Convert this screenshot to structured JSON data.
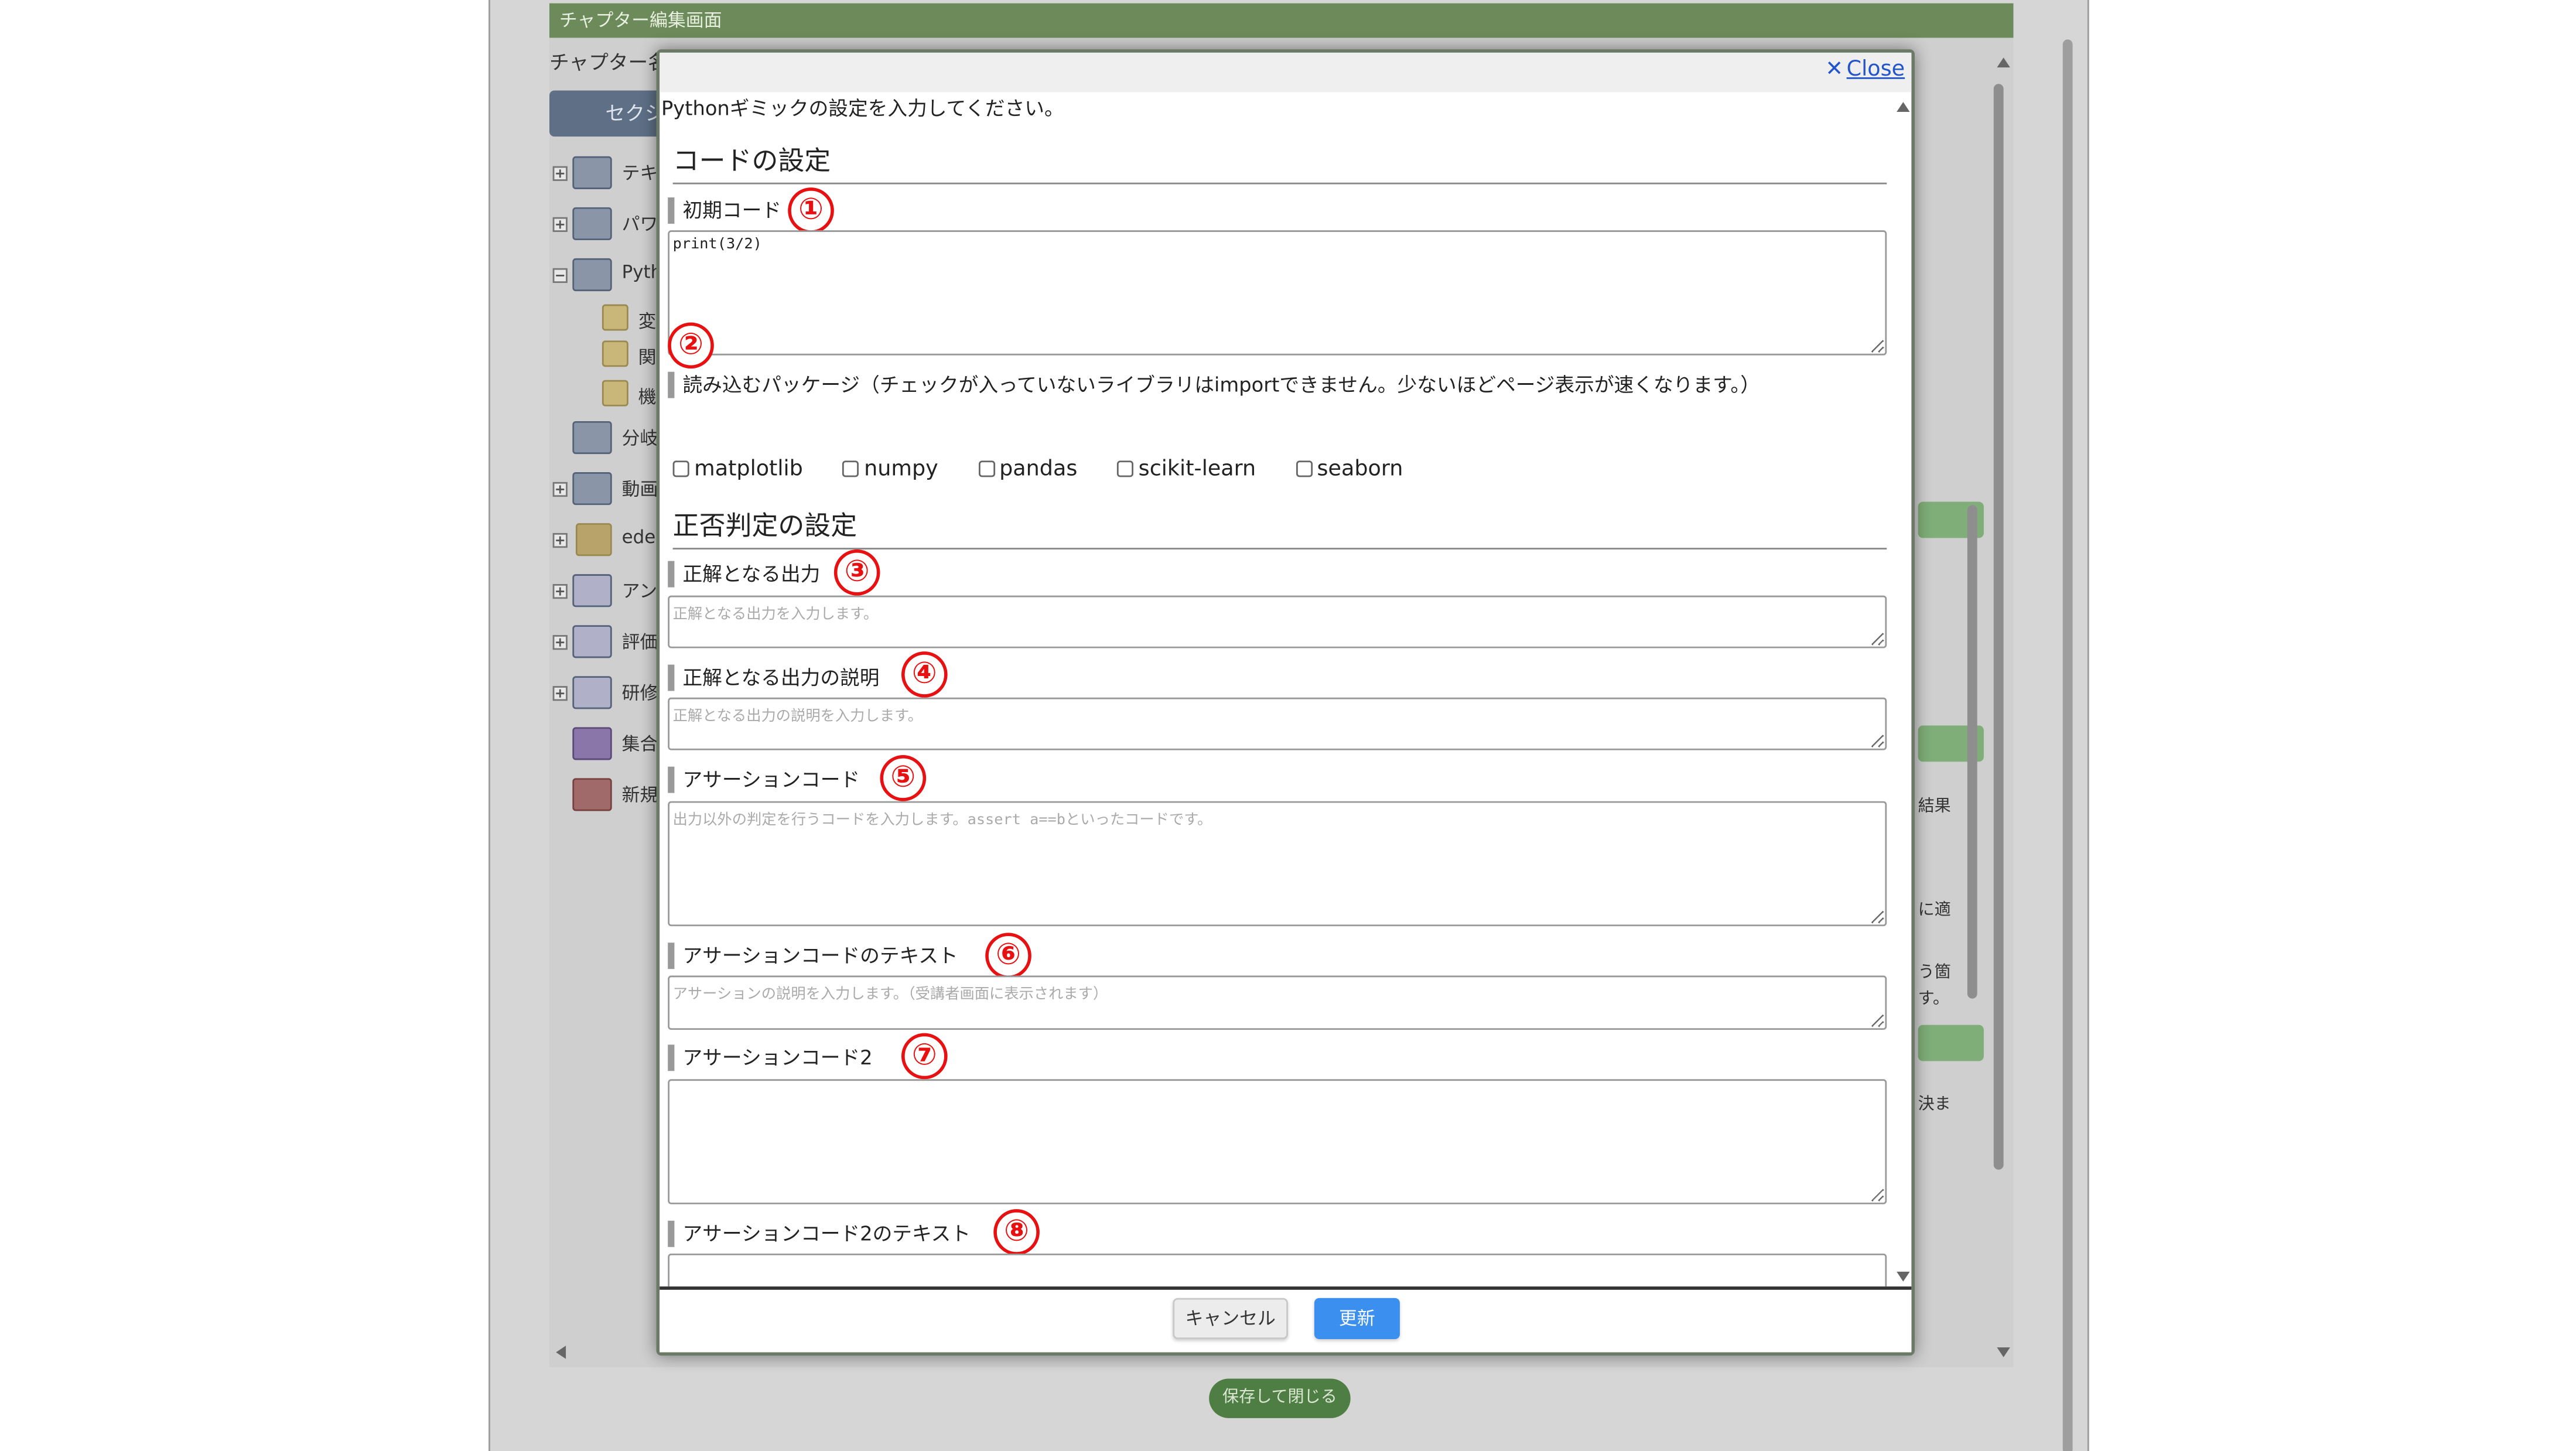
{
  "page": {
    "title": "チャプター編集画面",
    "chapter_label": "チャプター名",
    "section_button": "セクシ",
    "tree_items": [
      {
        "label": "テキ",
        "sub": false,
        "icon": "slide-icon",
        "toggle": "plus"
      },
      {
        "label": "パワ",
        "sub": false,
        "icon": "slide-icon",
        "toggle": "plus"
      },
      {
        "label": "Pyth",
        "sub": false,
        "icon": "slide-icon",
        "toggle": "minus"
      },
      {
        "label": "変",
        "sub": true,
        "icon": "note-icon",
        "toggle": ""
      },
      {
        "label": "関",
        "sub": true,
        "icon": "note-icon",
        "toggle": ""
      },
      {
        "label": "機",
        "sub": true,
        "icon": "note-icon",
        "toggle": ""
      },
      {
        "label": "分岐",
        "sub": false,
        "icon": "slide-icon",
        "toggle": ""
      },
      {
        "label": "動画",
        "sub": false,
        "icon": "slide-icon",
        "toggle": "plus"
      },
      {
        "label": "eden",
        "sub": false,
        "icon": "person-icon",
        "toggle": "plus"
      },
      {
        "label": "アン",
        "sub": false,
        "icon": "questionnaire-icon",
        "toggle": "plus"
      },
      {
        "label": "評価",
        "sub": false,
        "icon": "questionnaire-icon",
        "toggle": "plus"
      },
      {
        "label": "研修",
        "sub": false,
        "icon": "questionnaire-icon",
        "toggle": "plus"
      },
      {
        "label": "集合",
        "sub": false,
        "icon": "people-icon",
        "toggle": ""
      },
      {
        "label": "新規",
        "sub": false,
        "icon": "pdf-icon",
        "toggle": ""
      }
    ],
    "right_texts": [
      "結果",
      "に適",
      "う箇",
      "す。",
      "決ま"
    ],
    "save_close_label": "保存して閉じる"
  },
  "dialog": {
    "close_label": "Close",
    "intro": "Pythonギミックの設定を入力してください。",
    "code_section": "コードの設定",
    "initial_code_label": "初期コード",
    "initial_code_value": "print(3/2)",
    "packages_label": "読み込むパッケージ（チェックが入っていないライブラリはimportできません。少ないほどページ表示が速くなります。）",
    "packages": [
      "matplotlib",
      "numpy",
      "pandas",
      "scikit-learn",
      "seaborn"
    ],
    "judge_section": "正否判定の設定",
    "correct_output_label": "正解となる出力",
    "correct_output_placeholder": "正解となる出力を入力します。",
    "correct_output_desc_label": "正解となる出力の説明",
    "correct_output_desc_placeholder": "正解となる出力の説明を入力します。",
    "assertion_code_label": "アサーションコード",
    "assertion_code_placeholder": "出力以外の判定を行うコードを入力します。assert a==bといったコードです。",
    "assertion_text_label": "アサーションコードのテキスト",
    "assertion_text_placeholder": "アサーションの説明を入力します。（受講者画面に表示されます）",
    "assertion_code2_label": "アサーションコード2",
    "assertion_text2_label": "アサーションコード2のテキスト",
    "cancel_label": "キャンセル",
    "update_label": "更新",
    "markers": [
      "①",
      "②",
      "③",
      "④",
      "⑤",
      "⑥",
      "⑦",
      "⑧"
    ],
    "colors": {
      "marker": "#e81010",
      "update": "#3b8fef",
      "title_bar": "#6c8a5a"
    }
  }
}
